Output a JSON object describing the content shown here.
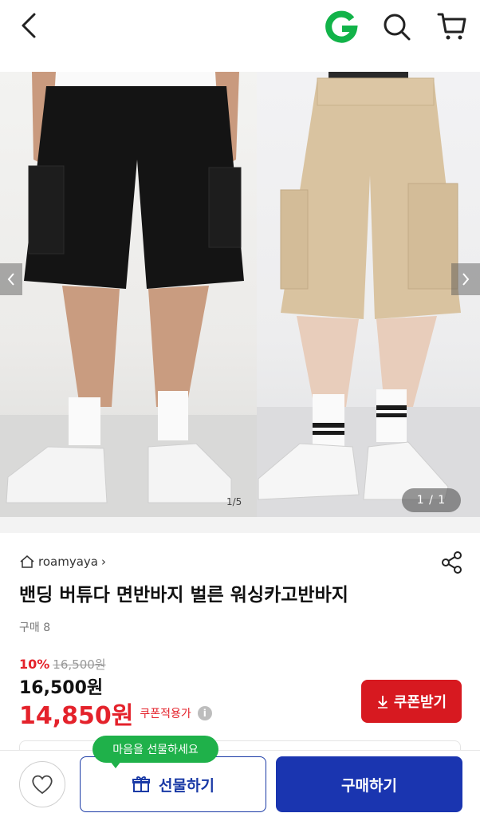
{
  "header": {
    "back_icon": "chevron-left-icon",
    "logo_letter": "G",
    "logo_color": "#12b349",
    "search_icon": "search-icon",
    "cart_icon": "cart-icon"
  },
  "gallery": {
    "left_counter": "1/5",
    "pager": "1 / 1",
    "prev_icon": "chevron-left-icon",
    "next_icon": "chevron-right-icon"
  },
  "product": {
    "seller": "roamyaya",
    "seller_chevron": "›",
    "title": "밴딩 버튜다 면반바지 벌른 워싱카고반바지",
    "purchase_count": "구매 8",
    "discount_rate": "10%",
    "original_price": "16,500원",
    "sale_price": "16,500원",
    "coupon_price": "14,850원",
    "coupon_label": "쿠폰적용가",
    "info_glyph": "i",
    "coupon_button": "쿠폰받기"
  },
  "bottom_bar": {
    "tooltip": "마음을 선물하세요",
    "gift_button": "선물하기",
    "buy_button": "구매하기"
  },
  "colors": {
    "accent_red": "#d71920",
    "price_red": "#e4222b",
    "primary_blue": "#1a35b0",
    "tooltip_green": "#1fb14a"
  }
}
